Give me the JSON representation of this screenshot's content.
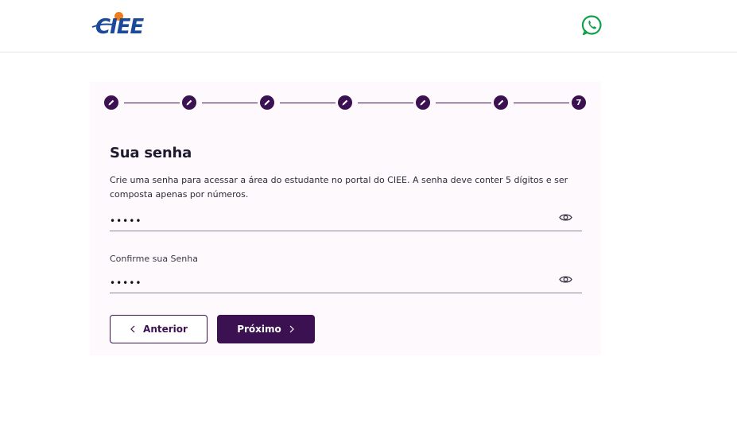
{
  "header": {
    "logo_text": "CIEE",
    "logo_colors": {
      "blue": "#1c4a9a",
      "orange": "#f07c1c"
    },
    "whatsapp_icon": "whatsapp-icon",
    "whatsapp_color": "#12a04c"
  },
  "stepper": {
    "total_steps": 7,
    "completed_icon": "pencil-icon",
    "current_step_label": "7",
    "accent": "#3b1151"
  },
  "form": {
    "title": "Sua senha",
    "description": "Crie uma senha para acessar a área do estudante no portal do CIEE. A senha deve conter 5 dígitos e ser composta apenas por números.",
    "password_value": "•••••",
    "confirm_label": "Confirme sua Senha",
    "confirm_value": "•••••",
    "toggle_icon": "eye-icon"
  },
  "buttons": {
    "previous_label": "Anterior",
    "next_label": "Próximo"
  }
}
